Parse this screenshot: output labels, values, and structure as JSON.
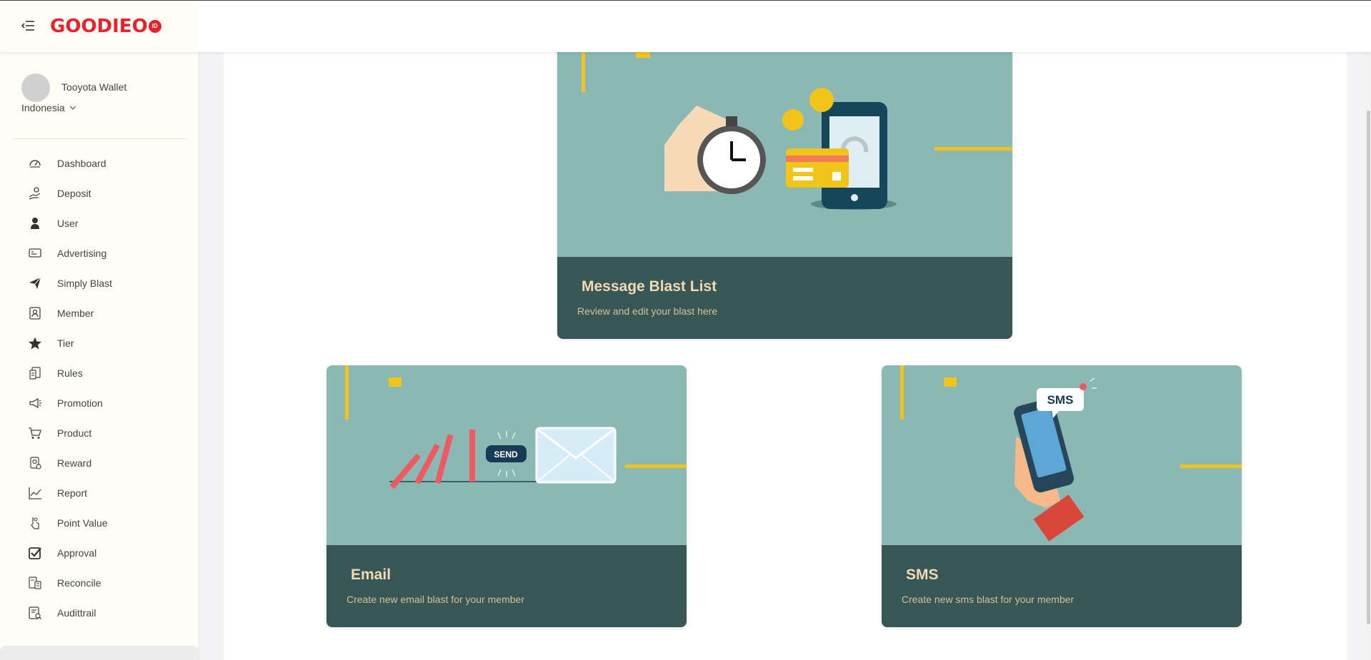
{
  "brand": {
    "logo_text": "GOODIEO",
    "logo_badge": "ID"
  },
  "profile": {
    "name": "Tooyota Wallet",
    "country": "Indonesia"
  },
  "sidebar": {
    "items": [
      {
        "label": "Dashboard",
        "icon": "dashboard-icon"
      },
      {
        "label": "Deposit",
        "icon": "deposit-icon"
      },
      {
        "label": "User",
        "icon": "user-icon"
      },
      {
        "label": "Advertising",
        "icon": "advertising-icon"
      },
      {
        "label": "Simply Blast",
        "icon": "paper-plane-icon"
      },
      {
        "label": "Member",
        "icon": "member-icon"
      },
      {
        "label": "Tier",
        "icon": "star-icon"
      },
      {
        "label": "Rules",
        "icon": "rules-icon"
      },
      {
        "label": "Promotion",
        "icon": "megaphone-icon"
      },
      {
        "label": "Product",
        "icon": "cart-icon"
      },
      {
        "label": "Reward",
        "icon": "reward-icon"
      },
      {
        "label": "Report",
        "icon": "chart-line-icon"
      },
      {
        "label": "Point Value",
        "icon": "point-value-icon"
      },
      {
        "label": "Approval",
        "icon": "checkbox-icon"
      },
      {
        "label": "Reconcile",
        "icon": "reconcile-icon"
      },
      {
        "label": "Audittrail",
        "icon": "audit-icon"
      }
    ]
  },
  "cards": {
    "blast_list": {
      "title": "Message Blast List",
      "subtitle": "Review and edit your blast here"
    },
    "email": {
      "title": "Email",
      "subtitle": "Create new email blast for your member",
      "send_label": "SEND"
    },
    "sms": {
      "title": "SMS",
      "subtitle": "Create new sms blast for your member",
      "bubble_label": "SMS"
    }
  },
  "colors": {
    "card_top": "#8bb8b4",
    "card_footer": "#375655",
    "title": "#f1d9b5",
    "subtitle": "#d3c29d",
    "brand_red": "#e8222a",
    "accent_yellow": "#f0c419"
  }
}
